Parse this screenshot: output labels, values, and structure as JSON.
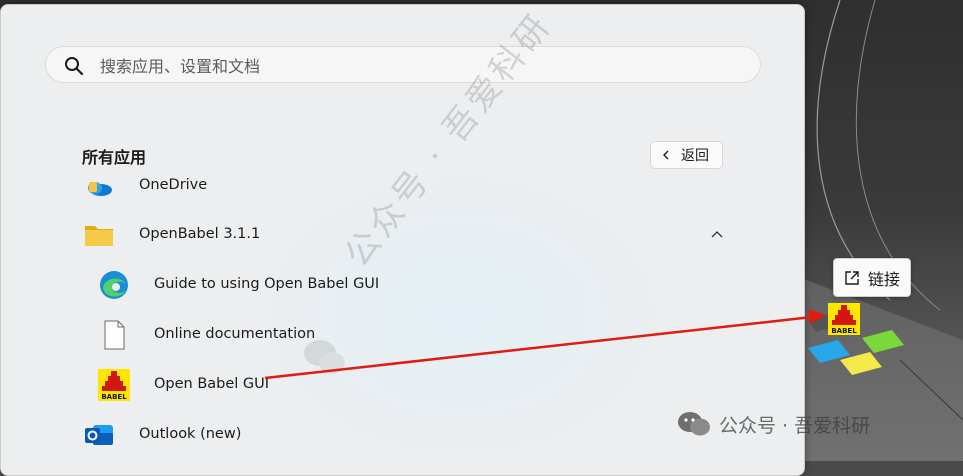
{
  "search": {
    "placeholder": "搜索应用、设置和文档",
    "icon": "search-icon"
  },
  "all_apps": {
    "title": "所有应用",
    "back_label": "返回"
  },
  "apps": [
    {
      "label": "OneDrive",
      "icon": "onedrive-icon"
    },
    {
      "label": "OpenBabel 3.1.1",
      "icon": "folder-icon",
      "expanded": true
    },
    {
      "label": "Guide to using Open Babel GUI",
      "icon": "edge-icon"
    },
    {
      "label": "Online documentation",
      "icon": "document-icon"
    },
    {
      "label": "Open Babel GUI",
      "icon": "openbabel-icon"
    },
    {
      "label": "Outlook (new)",
      "icon": "outlook-icon"
    }
  ],
  "app_icon_text": "BABEL",
  "desktop": {
    "link_label": "链接",
    "link_icon": "external-link-icon"
  },
  "watermark": {
    "diagonal": "公众号 · 吾爱科研",
    "bottom": "公众号 · 吾爱科研"
  },
  "colors": {
    "arrow": "#e01b12",
    "panel": "#eceef0",
    "folder": "#f5c542"
  }
}
